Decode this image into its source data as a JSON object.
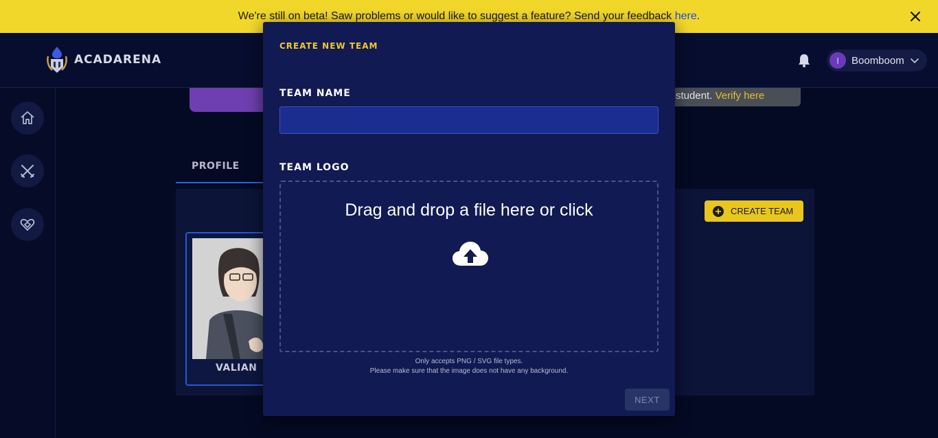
{
  "banner": {
    "message": "We're still on beta! Saw problems or would like to suggest a feature? Send your feedback ",
    "link_text": "here",
    "period": "."
  },
  "header": {
    "brand": "ACADARENA",
    "user_initial": "I",
    "user_name": "Boomboom"
  },
  "background": {
    "verify_text": "student. ",
    "verify_link": "Verify here",
    "profile_tab": "PROFILE",
    "card_name": "VALIAN",
    "create_team_label": "CREATE TEAM"
  },
  "modal": {
    "title": "CREATE NEW TEAM",
    "team_name_label": "TEAM NAME",
    "team_name_value": "",
    "team_logo_label": "TEAM LOGO",
    "dropzone_text": "Drag and drop a file here or click",
    "hint_line1": "Only accepts PNG / SVG file types.",
    "hint_line2": "Please make sure that the image does not have any background.",
    "next_label": "NEXT"
  },
  "colors": {
    "banner_bg": "#f2d72b",
    "page_bg": "#050a24",
    "modal_bg": "#111a52",
    "accent_yellow": "#f2c82c",
    "link_blue": "#1b4fd8"
  },
  "icons": {
    "banner_close": "close-icon",
    "bell": "bell-icon",
    "user_dropdown": "chevron-down-icon",
    "rail": [
      "home-icon",
      "crossed-swords-icon",
      "heart-handshake-icon"
    ],
    "upload": "cloud-upload-icon",
    "create_team": "plus-circle-icon"
  }
}
